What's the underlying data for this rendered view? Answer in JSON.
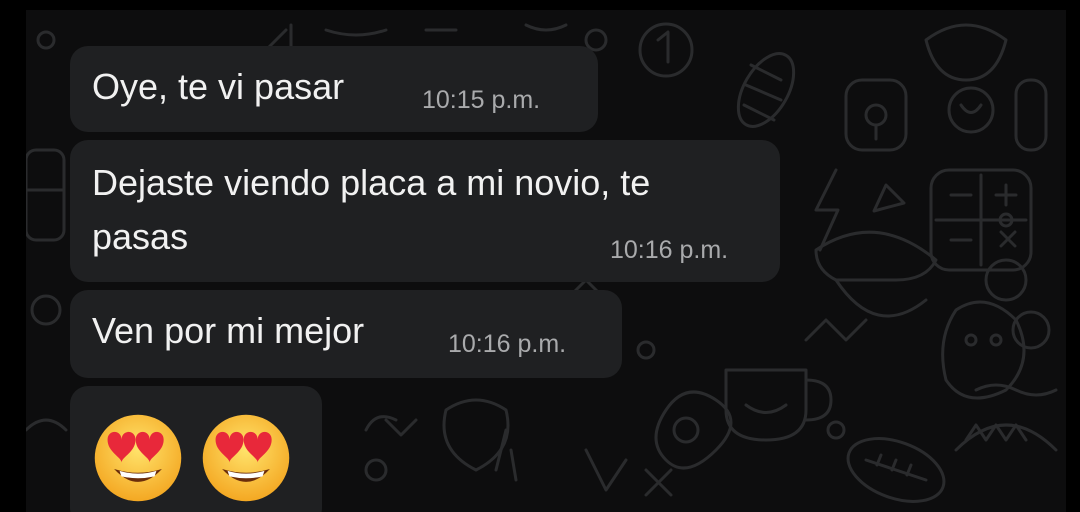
{
  "chat": {
    "messages": [
      {
        "text": "Oye, te vi pasar",
        "time": "10:15 p.m."
      },
      {
        "text_line1": "Dejaste viendo placa a mi novio, te",
        "text_line2": "pasas",
        "time": "10:16 p.m."
      },
      {
        "text": "Ven por mi mejor",
        "time": "10:16 p.m."
      },
      {
        "emojis": [
          "heart-eyes-emoji",
          "heart-eyes-emoji"
        ]
      }
    ],
    "theme": {
      "bubble_color": "#1f2022",
      "text_color": "#f1f1f1",
      "time_color": "#a9aaac",
      "wallpaper_color": "#0d0d0e",
      "doodle_color": "#2b2c2e"
    }
  }
}
